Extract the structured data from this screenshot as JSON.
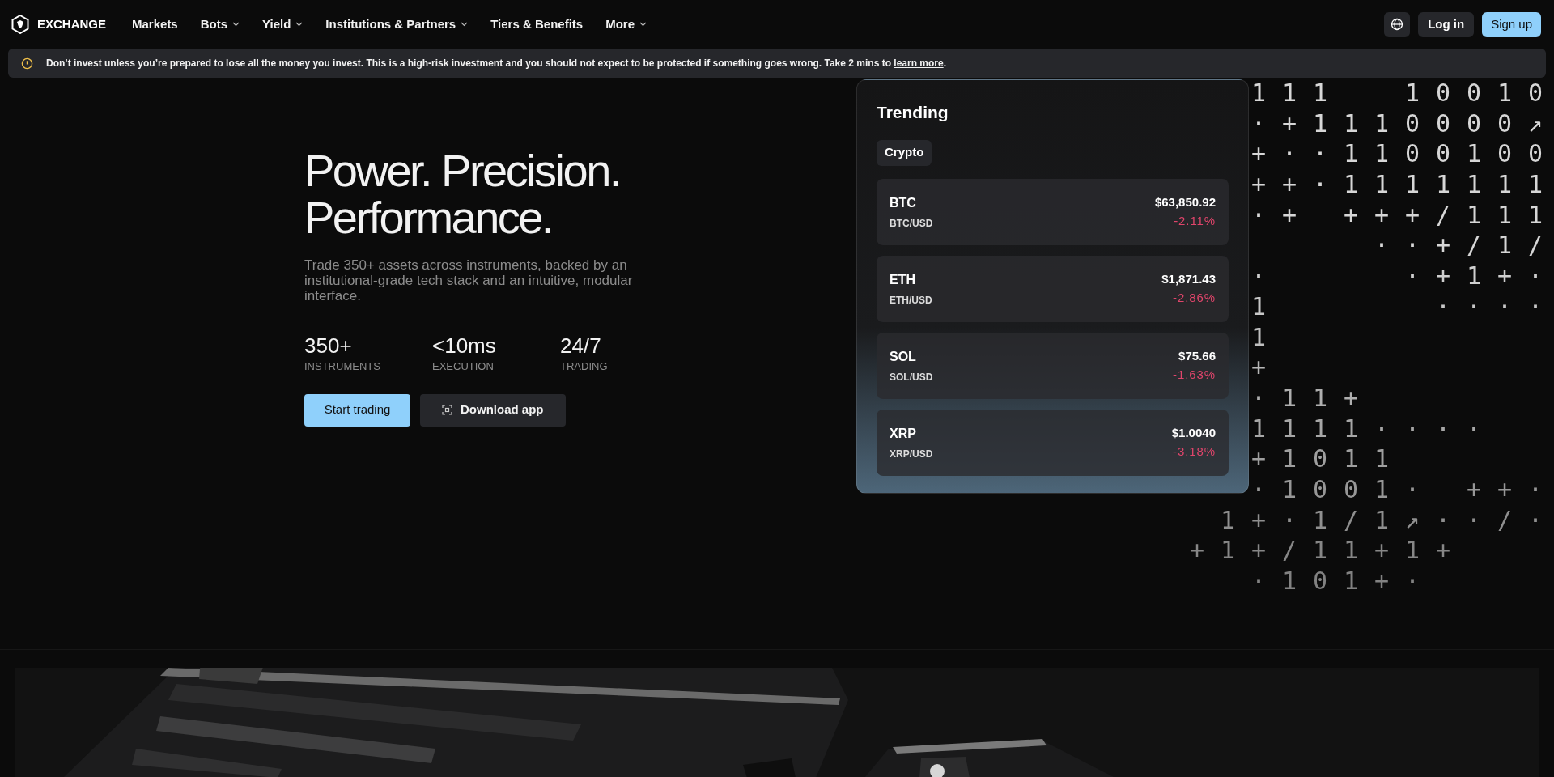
{
  "nav": {
    "logo_text": "EXCHANGE",
    "items": [
      {
        "label": "Markets",
        "dropdown": false
      },
      {
        "label": "Bots",
        "dropdown": true
      },
      {
        "label": "Yield",
        "dropdown": true
      },
      {
        "label": "Institutions & Partners",
        "dropdown": true
      },
      {
        "label": "Tiers & Benefits",
        "dropdown": false
      },
      {
        "label": "More",
        "dropdown": true
      }
    ],
    "actions": [
      {
        "label": "Log in",
        "kind": "secondary"
      },
      {
        "label": "Sign up",
        "kind": "primary"
      }
    ]
  },
  "banner": {
    "text": "Don’t invest unless you’re prepared to lose all the money you invest. This is a high-risk investment and you should not expect to be protected if something goes wrong. Take 2 mins to",
    "link": "learn more",
    "end": "."
  },
  "hero": {
    "title": "Power. Precision. Performance.",
    "subtitle": "Trade 350+ assets across instruments, backed by an institutional-grade tech stack and an intuitive, modular interface.",
    "stats": [
      {
        "value": "350+",
        "label": "INSTRUMENTS"
      },
      {
        "value": "<10ms",
        "label": "EXECUTION"
      },
      {
        "value": "24/7",
        "label": "TRADING"
      }
    ],
    "buttons": [
      {
        "label": "Start trading",
        "kind": "primary"
      },
      {
        "label": "Download app",
        "kind": "secondary"
      }
    ]
  },
  "trending": {
    "title": "Trending",
    "tabs": [
      {
        "label": "Crypto",
        "selected": true
      }
    ],
    "rows": [
      {
        "symbol": "BTC",
        "pair": "BTC/USD",
        "price": "$63,850.92",
        "change": "-2.11%"
      },
      {
        "symbol": "ETH",
        "pair": "ETH/USD",
        "price": "$1,871.43",
        "change": "-2.86%"
      },
      {
        "symbol": "SOL",
        "pair": "SOL/USD",
        "price": "$75.66",
        "change": "-1.63%"
      },
      {
        "symbol": "XRP",
        "pair": "XRP/USD",
        "price": "$1.0040",
        "change": "-3.18%"
      }
    ]
  },
  "pattern_rows": [
    "111  10010",
    "·+1110000↗",
    "+··1100100",
    "++·1111111",
    "·+ +++/111",
    "··+/1/",
    "·    ·+1+·",
    "1     ····",
    "1",
    "+",
    "·11+",
    "1111····",
    "+1011",
    "·1001· ++·",
    "1+·1/1↗··/·",
    "+1+/11+1+",
    "·101+·"
  ]
}
